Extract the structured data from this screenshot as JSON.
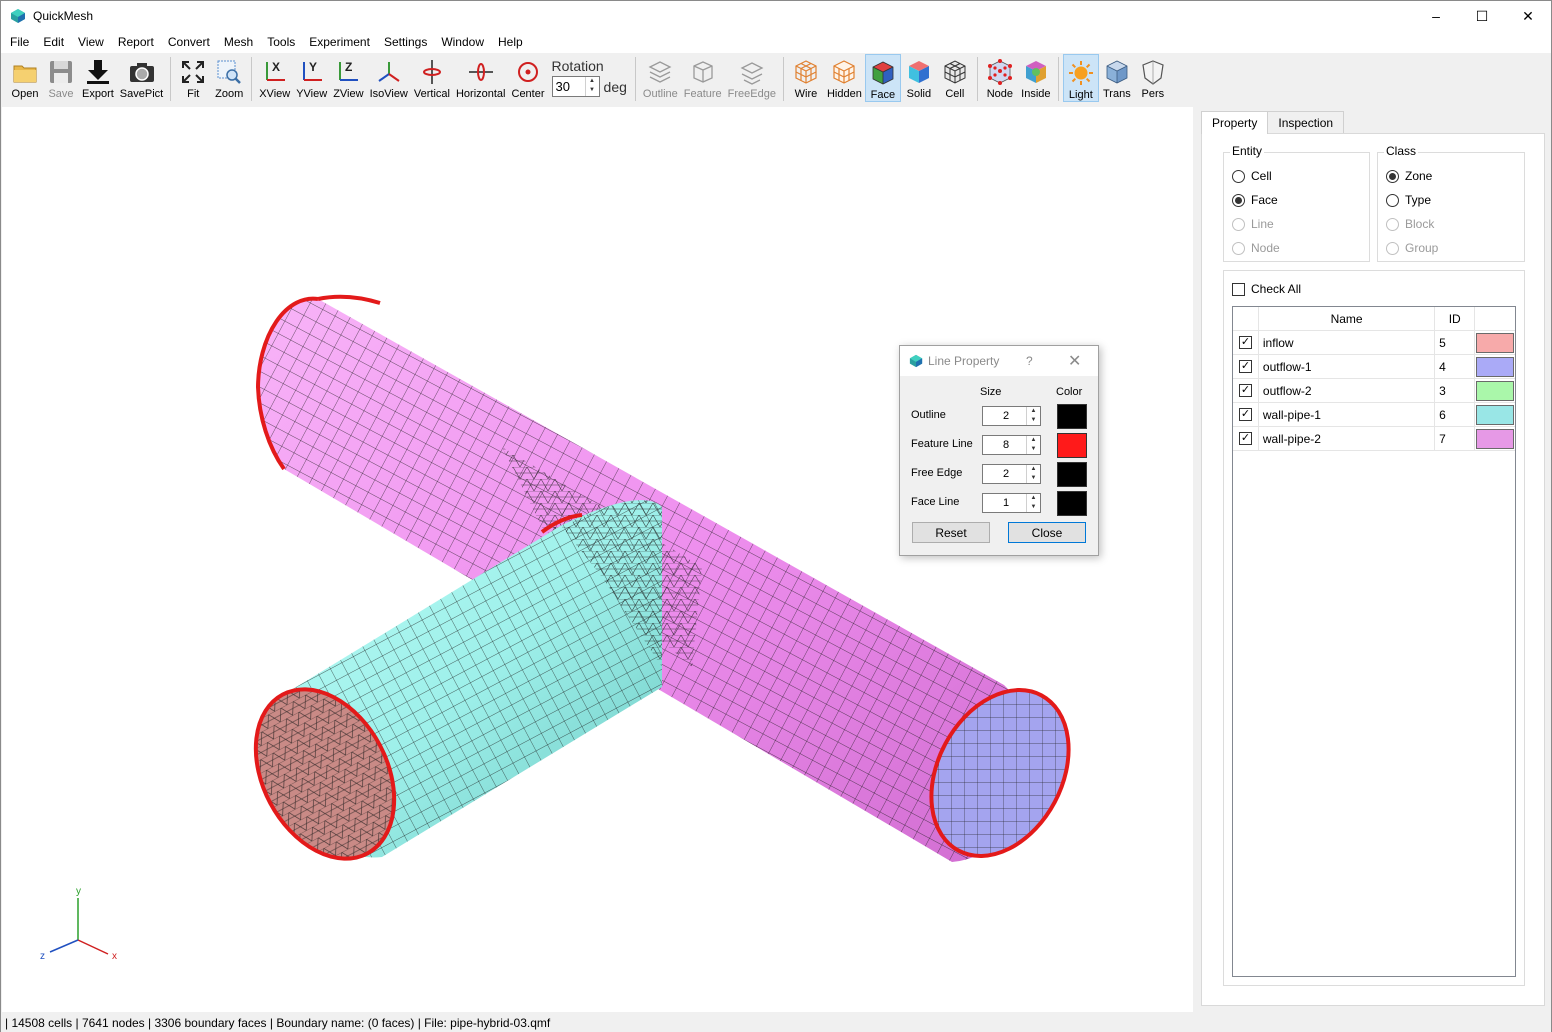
{
  "window": {
    "title": "QuickMesh",
    "minimize": "–",
    "maximize": "☐",
    "close": "✕"
  },
  "menu": [
    "File",
    "Edit",
    "View",
    "Report",
    "Convert",
    "Mesh",
    "Tools",
    "Experiment",
    "Settings",
    "Window",
    "Help"
  ],
  "toolbar": {
    "open": "Open",
    "save": "Save",
    "export": "Export",
    "savepict": "SavePict",
    "fit": "Fit",
    "zoom": "Zoom",
    "xview": "XView",
    "yview": "YView",
    "zview": "ZView",
    "isoview": "IsoView",
    "vertical": "Vertical",
    "horizontal": "Horizontal",
    "center": "Center",
    "rotation_label": "Rotation",
    "rotation_value": "30",
    "rotation_unit": "deg",
    "outline": "Outline",
    "feature": "Feature",
    "freeedge": "FreeEdge",
    "wire": "Wire",
    "hidden": "Hidden",
    "face": "Face",
    "solid": "Solid",
    "cell": "Cell",
    "node": "Node",
    "inside": "Inside",
    "light": "Light",
    "trans": "Trans",
    "pers": "Pers"
  },
  "panel": {
    "tabs": [
      "Property",
      "Inspection"
    ],
    "entity": {
      "title": "Entity",
      "options": [
        "Cell",
        "Face",
        "Line",
        "Node"
      ],
      "selected": "Face"
    },
    "class": {
      "title": "Class",
      "options": [
        "Zone",
        "Type",
        "Block",
        "Group"
      ],
      "selected": "Zone"
    },
    "check_all": "Check All",
    "table": {
      "headers": [
        "Name",
        "ID"
      ],
      "rows": [
        {
          "name": "inflow",
          "id": "5",
          "color": "#f7aaaa",
          "checked": true
        },
        {
          "name": "outflow-1",
          "id": "4",
          "color": "#aaaaf7",
          "checked": true
        },
        {
          "name": "outflow-2",
          "id": "3",
          "color": "#aaf7aa",
          "checked": true
        },
        {
          "name": "wall-pipe-1",
          "id": "6",
          "color": "#99e6e6",
          "checked": true
        },
        {
          "name": "wall-pipe-2",
          "id": "7",
          "color": "#e699e6",
          "checked": true
        }
      ]
    }
  },
  "dialog": {
    "title": "Line Property",
    "help": "?",
    "close": "✕",
    "col_size": "Size",
    "col_color": "Color",
    "rows": [
      {
        "label": "Outline",
        "size": "2",
        "color": "#000000"
      },
      {
        "label": "Feature Line",
        "size": "8",
        "color": "#ff1a1a"
      },
      {
        "label": "Free Edge",
        "size": "2",
        "color": "#000000"
      },
      {
        "label": "Face Line",
        "size": "1",
        "color": "#000000"
      }
    ],
    "reset": "Reset",
    "close_btn": "Close"
  },
  "axes": {
    "x": "x",
    "y": "y",
    "z": "z"
  },
  "status": "| 14508 cells | 7641 nodes | 3306 boundary faces |  Boundary name:  (0 faces) | File: pipe-hybrid-03.qmf",
  "colors": {
    "pipe1": "#f59df5",
    "pipe2": "#a3f5ee",
    "inflow": "#c98a86",
    "outflow": "#a4a4ef",
    "feature": "#e31a1a"
  }
}
